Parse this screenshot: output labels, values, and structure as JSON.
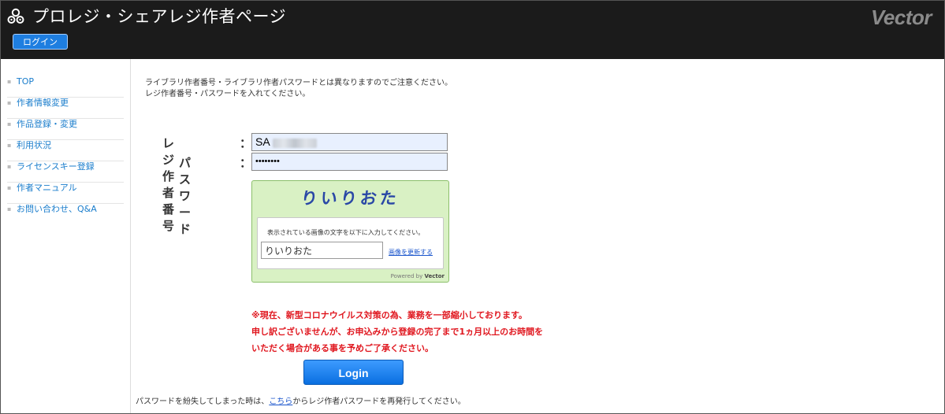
{
  "header": {
    "title": "プロレジ・シェアレジ作者ページ",
    "login_button": "ログイン",
    "brand": "Vector",
    "logo_icon": "user-gears-icon"
  },
  "sidebar": {
    "items": [
      {
        "label": "TOP"
      },
      {
        "label": "作者情報変更"
      },
      {
        "label": "作品登録・変更"
      },
      {
        "label": "利用状況"
      },
      {
        "label": "ライセンスキー登録"
      },
      {
        "label": "作者マニュアル"
      },
      {
        "label": "お問い合わせ、Q&A"
      }
    ]
  },
  "notice": {
    "line1": "ライブラリ作者番号・ライブラリ作者パスワードとは異なりますのでご注意ください。",
    "line2": "レジ作者番号・パスワードを入れてください。"
  },
  "form": {
    "id_label": "レジ作者番号",
    "password_label": "パスワード",
    "colon": "：",
    "id_value": "SA",
    "password_value": "••••••••"
  },
  "captcha": {
    "image_text": "りいりおた",
    "instruction": "表示されている画像の文字を以下に入力してください。",
    "input_value": "りいりおた",
    "refresh_link": "画像を更新する",
    "powered_prefix": "Powered by",
    "powered_brand": "Vector"
  },
  "warning": {
    "line1": "※現在、新型コロナウイルス対策の為、業務を一部縮小しております。",
    "line2": "申し訳ございませんが、お申込みから登録の完了まで1ヵ月以上のお時間を",
    "line3": "いただく場合がある事を予めご了承ください。"
  },
  "login_button": "Login",
  "lost_password": {
    "before": "パスワードを紛失してしまった時は、",
    "link": "こちら",
    "after": "からレジ作者パスワードを再発行してください。"
  },
  "colors": {
    "header_bg": "#1b1b1b",
    "accent": "#1e7ee0",
    "warning": "#e0171f",
    "captcha_bg": "#d9f1c4",
    "link": "#1a7dcc"
  }
}
